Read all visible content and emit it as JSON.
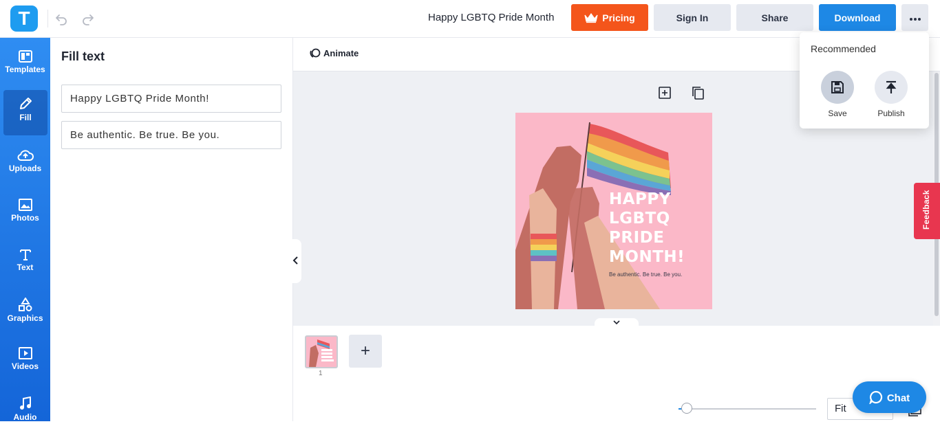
{
  "header": {
    "logo_letter": "T",
    "doc_title": "Happy LGBTQ Pride Month",
    "pricing_label": "Pricing",
    "signin_label": "Sign In",
    "share_label": "Share",
    "download_label": "Download",
    "more_label": "•••"
  },
  "leftnav": {
    "items": [
      {
        "label": "Templates",
        "icon": "templates-icon"
      },
      {
        "label": "Fill",
        "icon": "pencil-icon",
        "active": true
      },
      {
        "label": "Uploads",
        "icon": "cloud-upload-icon"
      },
      {
        "label": "Photos",
        "icon": "image-icon"
      },
      {
        "label": "Text",
        "icon": "text-icon"
      },
      {
        "label": "Graphics",
        "icon": "shapes-icon"
      },
      {
        "label": "Videos",
        "icon": "video-icon"
      },
      {
        "label": "Audio",
        "icon": "music-icon"
      }
    ]
  },
  "fill_panel": {
    "title": "Fill text",
    "fields": [
      {
        "value": "Happy LGBTQ Pride Month!"
      },
      {
        "value": "Be authentic. Be true. Be you."
      }
    ]
  },
  "canvas": {
    "animate_label": "Animate",
    "art_headline_lines": [
      "HAPPY",
      "LGBTQ",
      "PRIDE",
      "MONTH!"
    ],
    "art_subline": "Be authentic. Be true. Be you."
  },
  "pages": {
    "page_numbers": [
      "1"
    ],
    "add_label": "+"
  },
  "zoom": {
    "fit_label": "Fit"
  },
  "dropdown": {
    "title": "Recommended",
    "items": [
      {
        "label": "Save",
        "icon": "save-icon"
      },
      {
        "label": "Publish",
        "icon": "publish-icon"
      }
    ]
  },
  "feedback_label": "Feedback",
  "chat_label": "Chat",
  "colors": {
    "pricing": "#f4551b",
    "download": "#1e88e5",
    "nav_gradient_top": "#2f8df2",
    "nav_gradient_bottom": "#1465d8",
    "artboard_bg": "#fbb8c8",
    "feedback": "#e8364f"
  }
}
